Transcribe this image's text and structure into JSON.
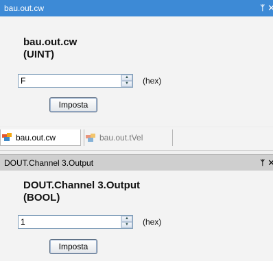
{
  "pane_top": {
    "title": "bau.out.cw",
    "pin_glyph": "ᛘ",
    "close_glyph": "✕",
    "var_name": "bau.out.cw",
    "var_type": "(UINT)",
    "value": "F",
    "format": "(hex)",
    "button_label": "Imposta"
  },
  "tabs": [
    {
      "label": "bau.out.cw",
      "selected": true
    },
    {
      "label": "bau.out.tVel",
      "selected": false
    }
  ],
  "pane_bottom": {
    "title": "DOUT.Channel 3.Output",
    "pin_glyph": "ᛘ",
    "close_glyph": "✕",
    "var_name": "DOUT.Channel 3.Output",
    "var_type": "(BOOL)",
    "value": "1",
    "format": "(hex)",
    "button_label": "Imposta"
  },
  "colors": {
    "active_title_bg": "#3d8ad6",
    "inactive_title_bg": "#cfcfcf"
  }
}
